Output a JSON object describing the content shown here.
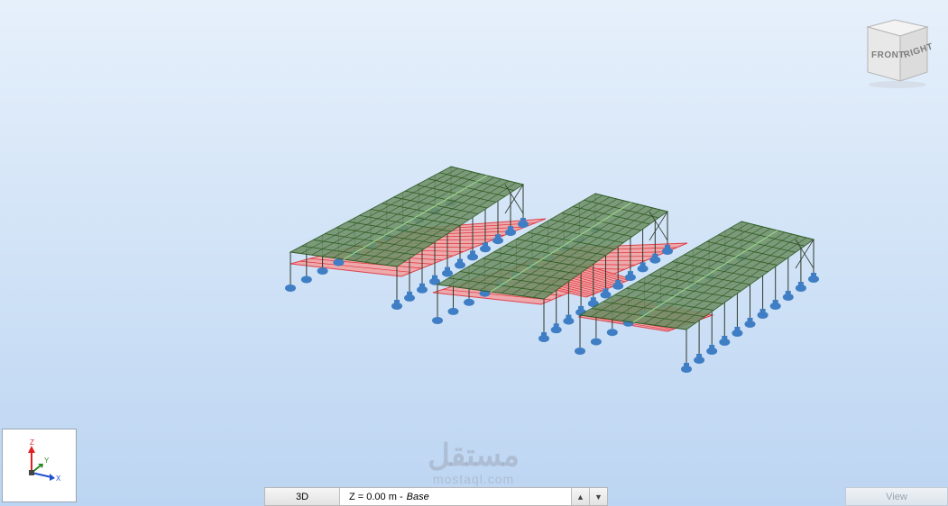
{
  "viewcube": {
    "front_label": "FRONT",
    "right_label": "RIGHT"
  },
  "axis": {
    "z": "Z",
    "y": "Y",
    "x": "X"
  },
  "status_bar": {
    "view_mode": "3D",
    "level_prefix": "Z = 0.00 m - ",
    "level_name": "Base",
    "up_arrow": "▲",
    "down_arrow": "▼"
  },
  "view_tab": {
    "label": "View"
  },
  "watermark": {
    "text": "مستقل",
    "url": "mostaql.com"
  },
  "colors": {
    "roof_fill": "#6f9068",
    "roof_lines": "#2e5a22",
    "slab_fill": "#f2a3a3",
    "slab_lines": "#e0303a",
    "column": "#2f3a2f",
    "support": "#3f7ec4",
    "axis_z": "#e02020",
    "axis_y": "#2a8a2a",
    "axis_x": "#2050d0"
  }
}
